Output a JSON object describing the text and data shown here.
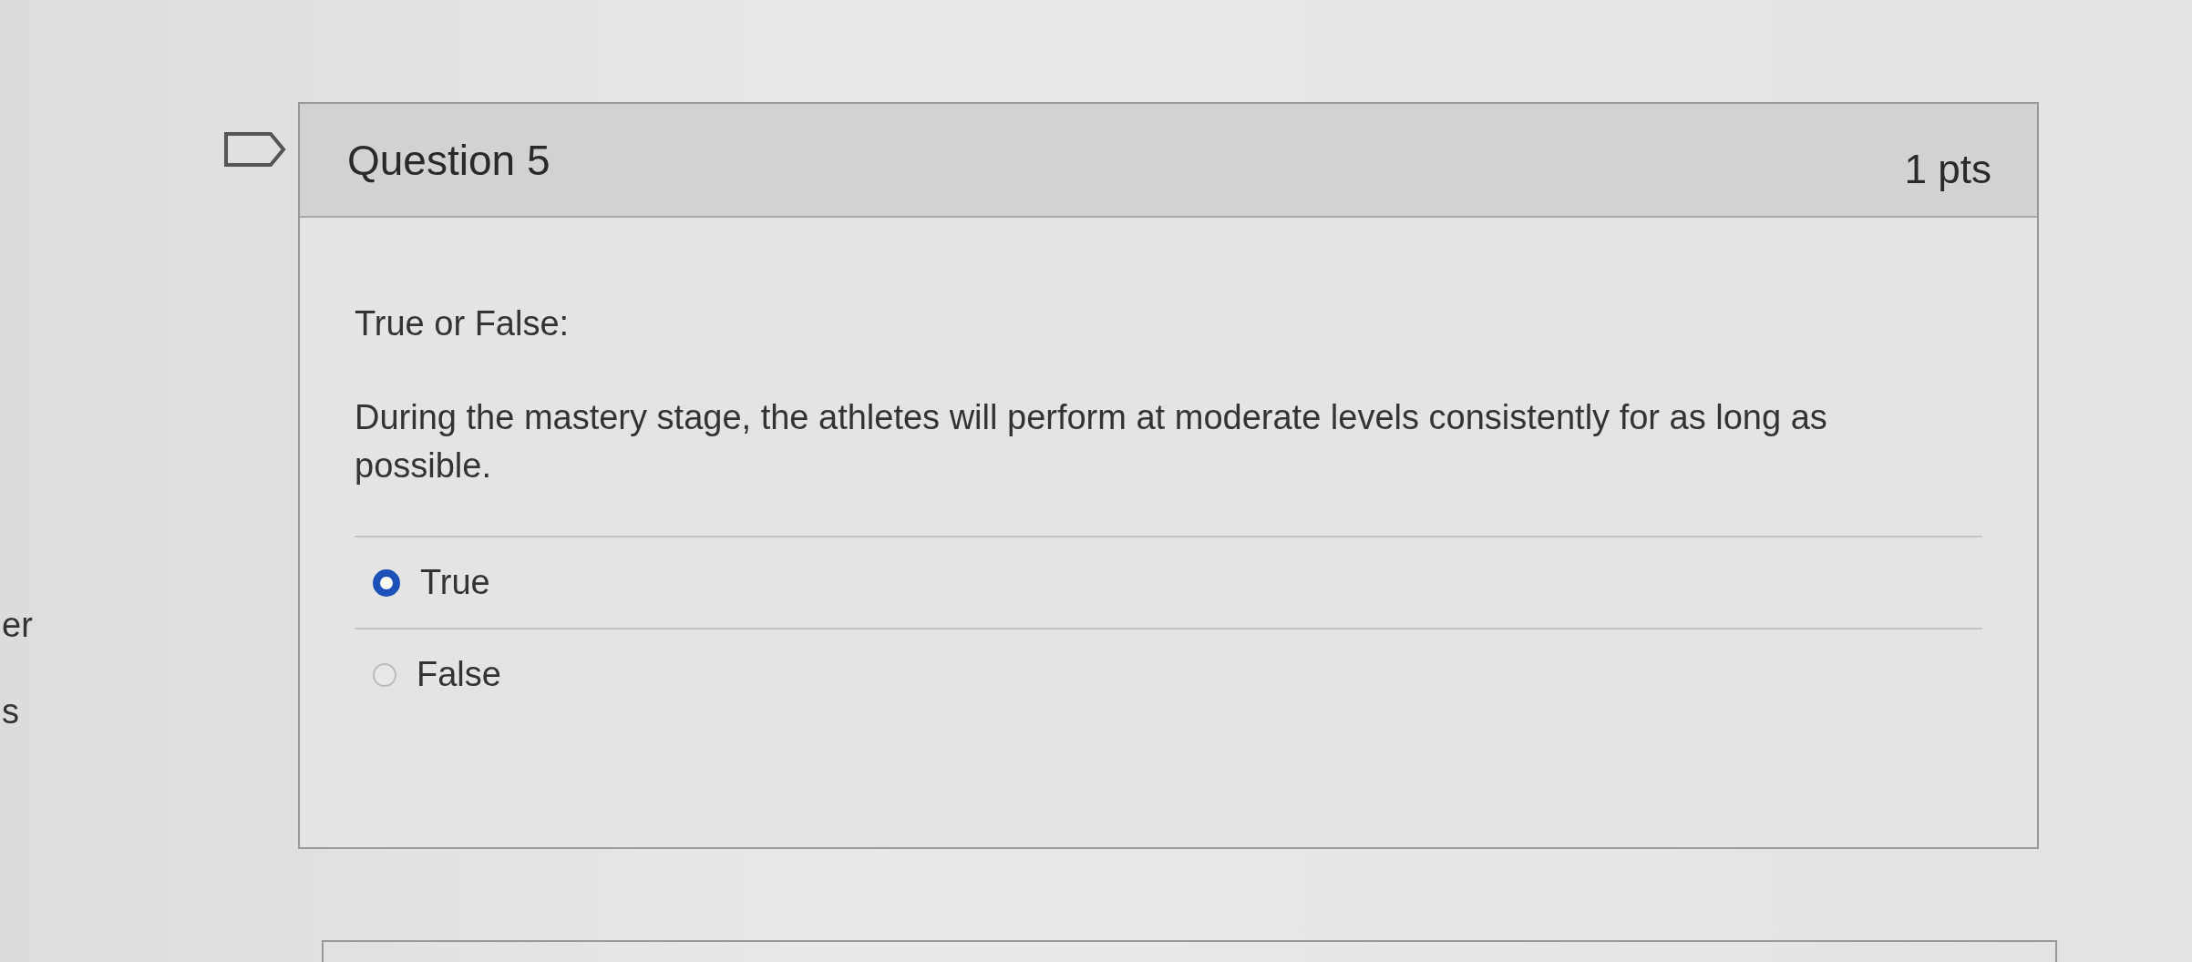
{
  "side_fragments": [
    "er",
    "s"
  ],
  "question": {
    "title": "Question 5",
    "points": "1 pts",
    "flagged": false,
    "intro": "True or False:",
    "text": "During the mastery stage, the athletes will perform at moderate levels consistently for as long as possible.",
    "answers": [
      {
        "label": "True",
        "selected": true
      },
      {
        "label": "False",
        "selected": false
      }
    ]
  }
}
